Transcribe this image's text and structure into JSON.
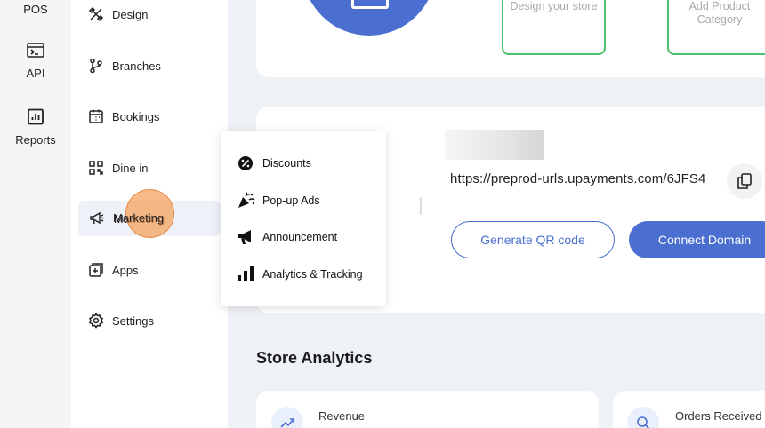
{
  "rail": {
    "items": [
      {
        "label": "POS"
      },
      {
        "label": "API"
      },
      {
        "label": "Reports"
      }
    ]
  },
  "sidebar": {
    "items": [
      {
        "label": "Design",
        "icon": "design-icon"
      },
      {
        "label": "Branches",
        "icon": "branches-icon"
      },
      {
        "label": "Bookings",
        "icon": "calendar-icon"
      },
      {
        "label": "Dine in",
        "icon": "qr-icon"
      },
      {
        "label": "Marketing",
        "icon": "megaphone-icon"
      },
      {
        "label": "Apps",
        "icon": "apps-icon"
      },
      {
        "label": "Settings",
        "icon": "gear-icon"
      }
    ],
    "active": "Marketing"
  },
  "marketing_menu": {
    "items": [
      {
        "label": "Discounts",
        "icon": "discount-icon"
      },
      {
        "label": "Pop-up Ads",
        "icon": "party-popper-icon"
      },
      {
        "label": "Announcement",
        "icon": "announcement-icon"
      },
      {
        "label": "Analytics & Tracking",
        "icon": "bar-chart-icon"
      }
    ]
  },
  "setup_steps": {
    "step1": "Design your store",
    "step2": "Add Product Category"
  },
  "store_link": {
    "url": "https://preprod-urls.upayments.com/6JFS4",
    "generate_qr_label": "Generate QR code",
    "connect_domain_label": "Connect Domain"
  },
  "analytics": {
    "title": "Store Analytics",
    "revenue_label": "Revenue",
    "orders_label": "Orders Received"
  },
  "colors": {
    "accent": "#4a6fd1",
    "step_border": "#4cc06a",
    "highlight": "#f5a05a"
  }
}
